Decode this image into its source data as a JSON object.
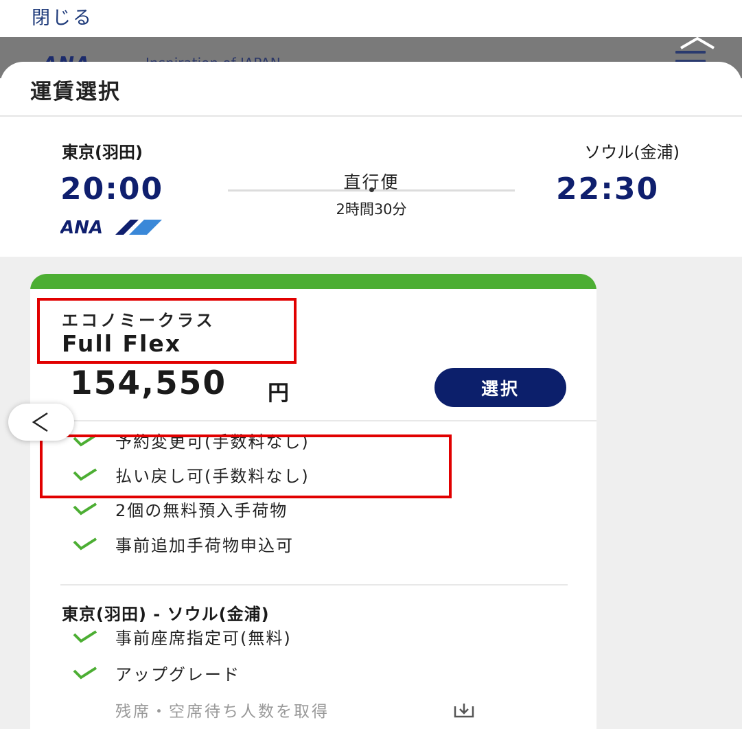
{
  "topbar": {
    "close_label": "閉じる"
  },
  "background_page": {
    "logo_text": "ANA",
    "tagline": "Inspiration of JAPAN"
  },
  "sheet": {
    "title": "運賃選択"
  },
  "flight": {
    "from_city": "東京(羽田)",
    "to_city": "ソウル(金浦)",
    "departure_time": "20:00",
    "arrival_time": "22:30",
    "flight_type": "直行便",
    "duration": "2時間30分",
    "airline_logo_text": "ANA"
  },
  "fare": {
    "cabin": "エコノミークラス",
    "name": "Full Flex",
    "price": "154,550",
    "currency": "円",
    "select_label": "選択",
    "features": [
      "予約変更可(手数料なし)",
      "払い戻し可(手数料なし)",
      "2個の無料預入手荷物",
      "事前追加手荷物申込可"
    ],
    "segment": {
      "title": "東京(羽田) - ソウル(金浦)",
      "features": [
        "事前座席指定可(無料)",
        "アップグレード"
      ],
      "sub_note": "残席・空席待ち人数を取得"
    }
  },
  "colors": {
    "brand_navy": "#0c1f6b",
    "band_green": "#4cae33",
    "check_green": "#4cae33",
    "highlight_red": "#e10000"
  },
  "icons": {
    "check": "check-icon",
    "back": "chevron-left-icon",
    "download": "download-icon",
    "menu": "hamburger-menu-icon",
    "collapse": "chevron-up-icon"
  }
}
